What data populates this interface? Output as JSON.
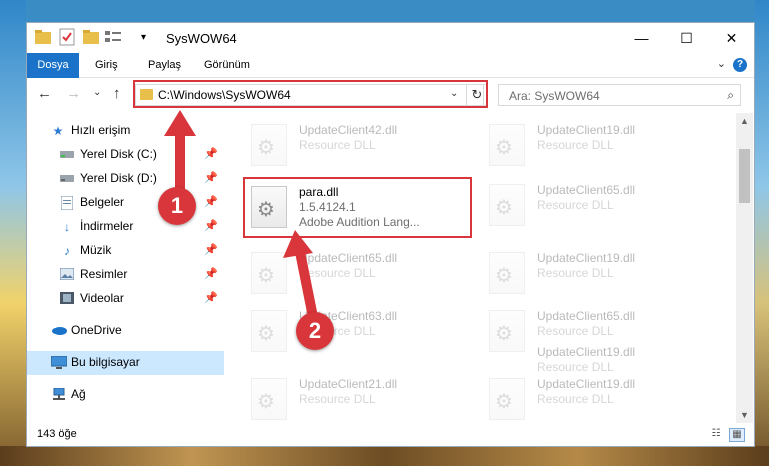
{
  "window": {
    "title": "SysWOW64"
  },
  "titlebar": {
    "minimize": "—",
    "maximize": "☐",
    "close": "✕"
  },
  "ribbon": {
    "tabs": [
      "Dosya",
      "Giriş",
      "Paylaş",
      "Görünüm"
    ],
    "help": "?"
  },
  "nav": {
    "address": "C:\\Windows\\SysWOW64",
    "search_placeholder": "Ara: SysWOW64"
  },
  "sidebar": {
    "items": [
      {
        "label": "Hızlı erişim",
        "icon": "star-icon",
        "pinned": false
      },
      {
        "label": "Yerel Disk (C:)",
        "icon": "drive-icon",
        "pinned": true
      },
      {
        "label": "Yerel Disk (D:)",
        "icon": "drive-icon",
        "pinned": true
      },
      {
        "label": "Belgeler",
        "icon": "documents-icon",
        "pinned": true
      },
      {
        "label": "İndirmeler",
        "icon": "download-icon",
        "pinned": true
      },
      {
        "label": "Müzik",
        "icon": "music-icon",
        "pinned": true
      },
      {
        "label": "Resimler",
        "icon": "pictures-icon",
        "pinned": true
      },
      {
        "label": "Videolar",
        "icon": "video-icon",
        "pinned": true
      },
      {
        "label": "OneDrive",
        "icon": "cloud-icon",
        "pinned": false
      },
      {
        "label": "Bu bilgisayar",
        "icon": "computer-icon",
        "pinned": false,
        "selected": true
      },
      {
        "label": "Ağ",
        "icon": "network-icon",
        "pinned": false
      }
    ]
  },
  "files": {
    "highlighted": {
      "name": "para.dll",
      "version": "1.5.4124.1",
      "description": "Adobe Audition Lang..."
    },
    "background": [
      {
        "name": "UpdateClient42.dll",
        "type": "Resource DLL"
      },
      {
        "name": "UpdateClient19.dll",
        "type": "Resource DLL"
      },
      {
        "name": "UpdateClient65.dll",
        "type": "Resource DLL"
      },
      {
        "name": "UpdateClient65.dll",
        "type": "Resource DLL"
      },
      {
        "name": "UpdateClient19.dll",
        "type": "Resource DLL"
      },
      {
        "name": "UpdateClient63.dll",
        "type": "Resource DLL"
      },
      {
        "name": "UpdateClient65.dll",
        "type": "Resource DLL"
      },
      {
        "name": "UpdateClient19.dll",
        "type": "Resource DLL"
      },
      {
        "name": "UpdateClient21.dll",
        "type": "Resource DLL"
      },
      {
        "name": "UpdateClient19.dll",
        "type": "Resource DLL"
      }
    ]
  },
  "status": {
    "item_count": "143 öğe"
  },
  "annotations": {
    "step1": "1",
    "step2": "2"
  },
  "colors": {
    "accent": "#1a73c9",
    "highlight_red": "#d8363a",
    "selection": "#cce8ff"
  }
}
